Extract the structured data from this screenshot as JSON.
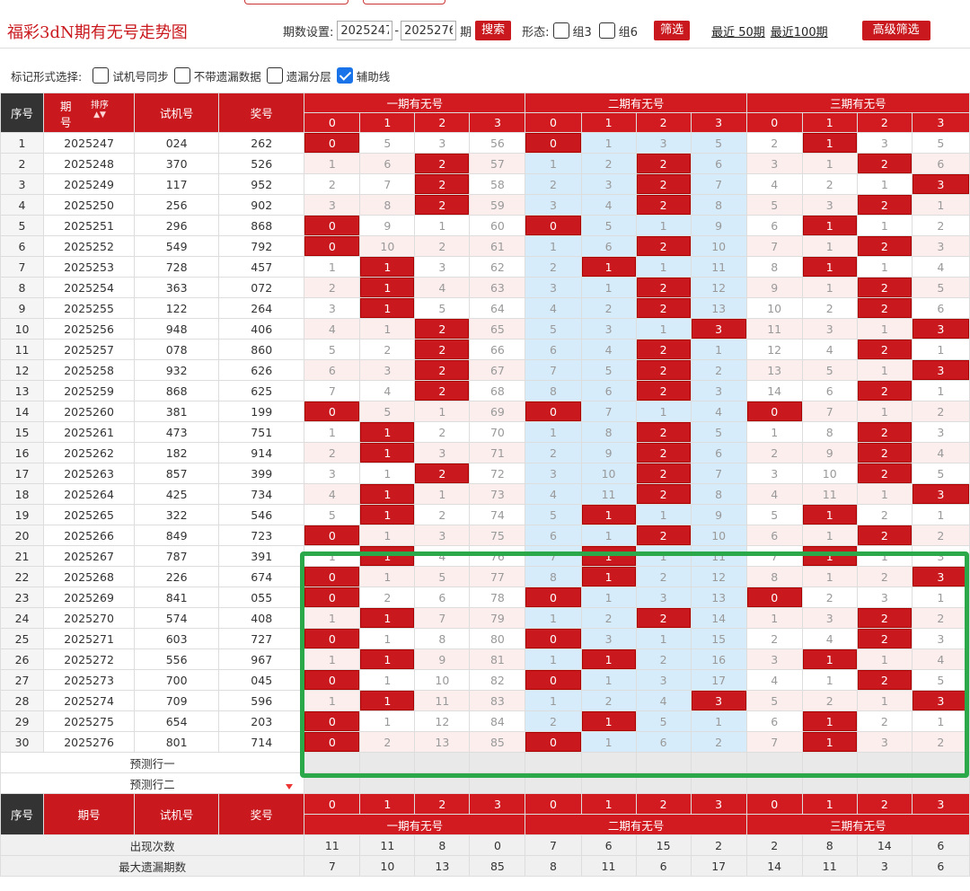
{
  "page": {
    "title": "福彩3dN期有无号走势图"
  },
  "controls": {
    "period_label": "期数设置:",
    "from": "2025247",
    "dash": "-",
    "to": "2025276",
    "period_unit": "期",
    "search": "搜索",
    "form_label": "形态:",
    "opt1": "组3",
    "opt2": "组6",
    "filter": "筛选",
    "recent50": "最近 50期",
    "recent100": "最近100期",
    "advanced": "高级筛选"
  },
  "markbar": {
    "label": "标记形式选择:",
    "opt1": "试机号同步",
    "opt2": "不带遗漏数据",
    "opt3": "遗漏分层",
    "opt4": "辅助线"
  },
  "header": {
    "seq": "序号",
    "issue": "期号",
    "sort": "排序",
    "test": "试机号",
    "prize": "奖号",
    "g1": "一期有无号",
    "g2": "二期有无号",
    "g3": "三期有无号",
    "cols": [
      "0",
      "1",
      "2",
      "3"
    ]
  },
  "rows": [
    {
      "n": "1",
      "issue": "2025247",
      "test": "024",
      "prize": "262",
      "g1": [
        "0",
        "5",
        "3",
        "56"
      ],
      "g2": [
        "0",
        "1",
        "3",
        "5"
      ],
      "g3": [
        "2",
        "1",
        "3",
        "5"
      ],
      "h1": 0,
      "h2": 0,
      "h3": 1
    },
    {
      "n": "2",
      "issue": "2025248",
      "test": "370",
      "prize": "526",
      "g1": [
        "1",
        "6",
        "2",
        "57"
      ],
      "g2": [
        "1",
        "2",
        "2",
        "6"
      ],
      "g3": [
        "3",
        "1",
        "2",
        "6"
      ],
      "h1": 2,
      "h2": 2,
      "h3": 2
    },
    {
      "n": "3",
      "issue": "2025249",
      "test": "117",
      "prize": "952",
      "g1": [
        "2",
        "7",
        "2",
        "58"
      ],
      "g2": [
        "2",
        "3",
        "2",
        "7"
      ],
      "g3": [
        "4",
        "2",
        "1",
        "3"
      ],
      "h1": 2,
      "h2": 2,
      "h3": 3
    },
    {
      "n": "4",
      "issue": "2025250",
      "test": "256",
      "prize": "902",
      "g1": [
        "3",
        "8",
        "2",
        "59"
      ],
      "g2": [
        "3",
        "4",
        "2",
        "8"
      ],
      "g3": [
        "5",
        "3",
        "2",
        "1"
      ],
      "h1": 2,
      "h2": 2,
      "h3": 2
    },
    {
      "n": "5",
      "issue": "2025251",
      "test": "296",
      "prize": "868",
      "g1": [
        "0",
        "9",
        "1",
        "60"
      ],
      "g2": [
        "0",
        "5",
        "1",
        "9"
      ],
      "g3": [
        "6",
        "1",
        "1",
        "2"
      ],
      "h1": 0,
      "h2": 0,
      "h3": 1
    },
    {
      "n": "6",
      "issue": "2025252",
      "test": "549",
      "prize": "792",
      "g1": [
        "0",
        "10",
        "2",
        "61"
      ],
      "g2": [
        "1",
        "6",
        "2",
        "10"
      ],
      "g3": [
        "7",
        "1",
        "2",
        "3"
      ],
      "h1": 0,
      "h2": 2,
      "h3": 2
    },
    {
      "n": "7",
      "issue": "2025253",
      "test": "728",
      "prize": "457",
      "g1": [
        "1",
        "1",
        "3",
        "62"
      ],
      "g2": [
        "2",
        "1",
        "1",
        "11"
      ],
      "g3": [
        "8",
        "1",
        "1",
        "4"
      ],
      "h1": 1,
      "h2": 1,
      "h3": 1
    },
    {
      "n": "8",
      "issue": "2025254",
      "test": "363",
      "prize": "072",
      "g1": [
        "2",
        "1",
        "4",
        "63"
      ],
      "g2": [
        "3",
        "1",
        "2",
        "12"
      ],
      "g3": [
        "9",
        "1",
        "2",
        "5"
      ],
      "h1": 1,
      "h2": 2,
      "h3": 2
    },
    {
      "n": "9",
      "issue": "2025255",
      "test": "122",
      "prize": "264",
      "g1": [
        "3",
        "1",
        "5",
        "64"
      ],
      "g2": [
        "4",
        "2",
        "2",
        "13"
      ],
      "g3": [
        "10",
        "2",
        "2",
        "6"
      ],
      "h1": 1,
      "h2": 2,
      "h3": 2
    },
    {
      "n": "10",
      "issue": "2025256",
      "test": "948",
      "prize": "406",
      "g1": [
        "4",
        "1",
        "2",
        "65"
      ],
      "g2": [
        "5",
        "3",
        "1",
        "3"
      ],
      "g3": [
        "11",
        "3",
        "1",
        "3"
      ],
      "h1": 2,
      "h2": 3,
      "h3": 3
    },
    {
      "n": "11",
      "issue": "2025257",
      "test": "078",
      "prize": "860",
      "g1": [
        "5",
        "2",
        "2",
        "66"
      ],
      "g2": [
        "6",
        "4",
        "2",
        "1"
      ],
      "g3": [
        "12",
        "4",
        "2",
        "1"
      ],
      "h1": 2,
      "h2": 2,
      "h3": 2
    },
    {
      "n": "12",
      "issue": "2025258",
      "test": "932",
      "prize": "626",
      "g1": [
        "6",
        "3",
        "2",
        "67"
      ],
      "g2": [
        "7",
        "5",
        "2",
        "2"
      ],
      "g3": [
        "13",
        "5",
        "1",
        "3"
      ],
      "h1": 2,
      "h2": 2,
      "h3": 3
    },
    {
      "n": "13",
      "issue": "2025259",
      "test": "868",
      "prize": "625",
      "g1": [
        "7",
        "4",
        "2",
        "68"
      ],
      "g2": [
        "8",
        "6",
        "2",
        "3"
      ],
      "g3": [
        "14",
        "6",
        "2",
        "1"
      ],
      "h1": 2,
      "h2": 2,
      "h3": 2
    },
    {
      "n": "14",
      "issue": "2025260",
      "test": "381",
      "prize": "199",
      "g1": [
        "0",
        "5",
        "1",
        "69"
      ],
      "g2": [
        "0",
        "7",
        "1",
        "4"
      ],
      "g3": [
        "0",
        "7",
        "1",
        "2"
      ],
      "h1": 0,
      "h2": 0,
      "h3": 0
    },
    {
      "n": "15",
      "issue": "2025261",
      "test": "473",
      "prize": "751",
      "g1": [
        "1",
        "1",
        "2",
        "70"
      ],
      "g2": [
        "1",
        "8",
        "2",
        "5"
      ],
      "g3": [
        "1",
        "8",
        "2",
        "3"
      ],
      "h1": 1,
      "h2": 2,
      "h3": 2
    },
    {
      "n": "16",
      "issue": "2025262",
      "test": "182",
      "prize": "914",
      "g1": [
        "2",
        "1",
        "3",
        "71"
      ],
      "g2": [
        "2",
        "9",
        "2",
        "6"
      ],
      "g3": [
        "2",
        "9",
        "2",
        "4"
      ],
      "h1": 1,
      "h2": 2,
      "h3": 2
    },
    {
      "n": "17",
      "issue": "2025263",
      "test": "857",
      "prize": "399",
      "g1": [
        "3",
        "1",
        "2",
        "72"
      ],
      "g2": [
        "3",
        "10",
        "2",
        "7"
      ],
      "g3": [
        "3",
        "10",
        "2",
        "5"
      ],
      "h1": 2,
      "h2": 2,
      "h3": 2
    },
    {
      "n": "18",
      "issue": "2025264",
      "test": "425",
      "prize": "734",
      "g1": [
        "4",
        "1",
        "1",
        "73"
      ],
      "g2": [
        "4",
        "11",
        "2",
        "8"
      ],
      "g3": [
        "4",
        "11",
        "1",
        "3"
      ],
      "h1": 1,
      "h2": 2,
      "h3": 3
    },
    {
      "n": "19",
      "issue": "2025265",
      "test": "322",
      "prize": "546",
      "g1": [
        "5",
        "1",
        "2",
        "74"
      ],
      "g2": [
        "5",
        "1",
        "1",
        "9"
      ],
      "g3": [
        "5",
        "1",
        "2",
        "1"
      ],
      "h1": 1,
      "h2": 1,
      "h3": 1
    },
    {
      "n": "20",
      "issue": "2025266",
      "test": "849",
      "prize": "723",
      "g1": [
        "0",
        "1",
        "3",
        "75"
      ],
      "g2": [
        "6",
        "1",
        "2",
        "10"
      ],
      "g3": [
        "6",
        "1",
        "2",
        "2"
      ],
      "h1": 0,
      "h2": 2,
      "h3": 2
    },
    {
      "n": "21",
      "issue": "2025267",
      "test": "787",
      "prize": "391",
      "g1": [
        "1",
        "1",
        "4",
        "76"
      ],
      "g2": [
        "7",
        "1",
        "1",
        "11"
      ],
      "g3": [
        "7",
        "1",
        "1",
        "3"
      ],
      "h1": 1,
      "h2": 1,
      "h3": 1
    },
    {
      "n": "22",
      "issue": "2025268",
      "test": "226",
      "prize": "674",
      "g1": [
        "0",
        "1",
        "5",
        "77"
      ],
      "g2": [
        "8",
        "1",
        "2",
        "12"
      ],
      "g3": [
        "8",
        "1",
        "2",
        "3"
      ],
      "h1": 0,
      "h2": 1,
      "h3": 3
    },
    {
      "n": "23",
      "issue": "2025269",
      "test": "841",
      "prize": "055",
      "g1": [
        "0",
        "2",
        "6",
        "78"
      ],
      "g2": [
        "0",
        "1",
        "3",
        "13"
      ],
      "g3": [
        "0",
        "2",
        "3",
        "1"
      ],
      "h1": 0,
      "h2": 0,
      "h3": 0
    },
    {
      "n": "24",
      "issue": "2025270",
      "test": "574",
      "prize": "408",
      "g1": [
        "1",
        "1",
        "7",
        "79"
      ],
      "g2": [
        "1",
        "2",
        "2",
        "14"
      ],
      "g3": [
        "1",
        "3",
        "2",
        "2"
      ],
      "h1": 1,
      "h2": 2,
      "h3": 2
    },
    {
      "n": "25",
      "issue": "2025271",
      "test": "603",
      "prize": "727",
      "g1": [
        "0",
        "1",
        "8",
        "80"
      ],
      "g2": [
        "0",
        "3",
        "1",
        "15"
      ],
      "g3": [
        "2",
        "4",
        "2",
        "3"
      ],
      "h1": 0,
      "h2": 0,
      "h3": 2
    },
    {
      "n": "26",
      "issue": "2025272",
      "test": "556",
      "prize": "967",
      "g1": [
        "1",
        "1",
        "9",
        "81"
      ],
      "g2": [
        "1",
        "1",
        "2",
        "16"
      ],
      "g3": [
        "3",
        "1",
        "1",
        "4"
      ],
      "h1": 1,
      "h2": 1,
      "h3": 1
    },
    {
      "n": "27",
      "issue": "2025273",
      "test": "700",
      "prize": "045",
      "g1": [
        "0",
        "1",
        "10",
        "82"
      ],
      "g2": [
        "0",
        "1",
        "3",
        "17"
      ],
      "g3": [
        "4",
        "1",
        "2",
        "5"
      ],
      "h1": 0,
      "h2": 0,
      "h3": 2
    },
    {
      "n": "28",
      "issue": "2025274",
      "test": "709",
      "prize": "596",
      "g1": [
        "1",
        "1",
        "11",
        "83"
      ],
      "g2": [
        "1",
        "2",
        "4",
        "3"
      ],
      "g3": [
        "5",
        "2",
        "1",
        "3"
      ],
      "h1": 1,
      "h2": 3,
      "h3": 3
    },
    {
      "n": "29",
      "issue": "2025275",
      "test": "654",
      "prize": "203",
      "g1": [
        "0",
        "1",
        "12",
        "84"
      ],
      "g2": [
        "2",
        "1",
        "5",
        "1"
      ],
      "g3": [
        "6",
        "1",
        "2",
        "1"
      ],
      "h1": 0,
      "h2": 1,
      "h3": 1
    },
    {
      "n": "30",
      "issue": "2025276",
      "test": "801",
      "prize": "714",
      "g1": [
        "0",
        "2",
        "13",
        "85"
      ],
      "g2": [
        "0",
        "1",
        "6",
        "2"
      ],
      "g3": [
        "7",
        "1",
        "3",
        "2"
      ],
      "h1": 0,
      "h2": 0,
      "h3": 1
    }
  ],
  "pred": {
    "row1": "预测行一",
    "row2": "预测行二"
  },
  "stats": {
    "appear_label": "出现次数",
    "appear": [
      "11",
      "11",
      "8",
      "0",
      "7",
      "6",
      "15",
      "2",
      "2",
      "8",
      "14",
      "6"
    ],
    "maxmiss_label": "最大遗漏期数",
    "maxmiss": [
      "7",
      "10",
      "13",
      "85",
      "8",
      "11",
      "6",
      "17",
      "14",
      "11",
      "3",
      "6"
    ]
  },
  "colors": {
    "accent": "#c9191e",
    "highlight": "#2aa84a",
    "mid_bg": "#d7ecfb",
    "alt_bg": "#fdeeee"
  }
}
